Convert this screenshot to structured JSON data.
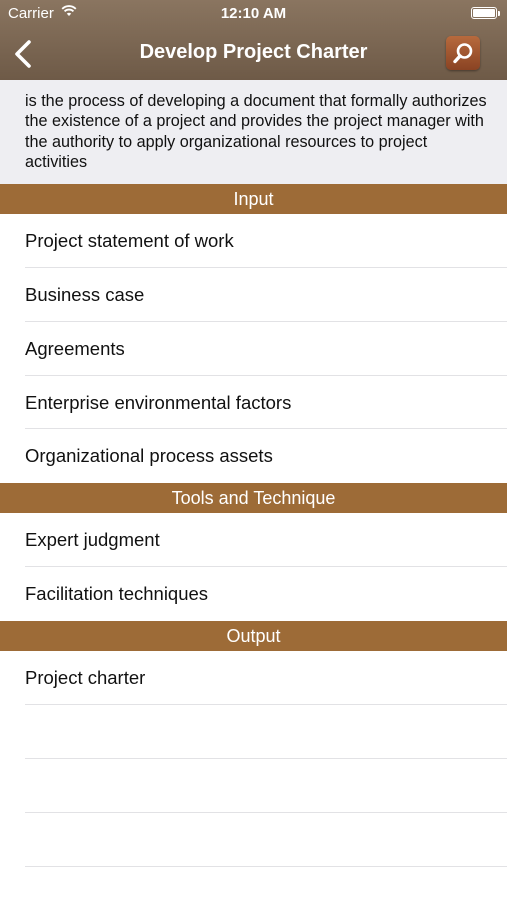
{
  "status_bar": {
    "carrier": "Carrier",
    "time": "12:10 AM"
  },
  "nav": {
    "title": "Develop Project Charter",
    "back_icon": "chevron-left-icon",
    "search_icon": "search-icon"
  },
  "description": "is the process of developing a document that formally authorizes the existence of a project and provides the project manager with the authority to apply organizational resources to project activities",
  "sections": [
    {
      "title": "Input",
      "items": [
        "Project statement of work",
        "Business case",
        "Agreements",
        "Enterprise environmental factors",
        "Organizational process assets"
      ]
    },
    {
      "title": "Tools and Technique",
      "items": [
        "Expert judgment",
        "Facilitation techniques"
      ]
    },
    {
      "title": "Output",
      "items": [
        "Project charter"
      ]
    }
  ],
  "colors": {
    "navbar": "#7c6753",
    "section_header": "#9d6b37",
    "search_button": "#a35a31",
    "description_bg": "#eeeef2"
  }
}
